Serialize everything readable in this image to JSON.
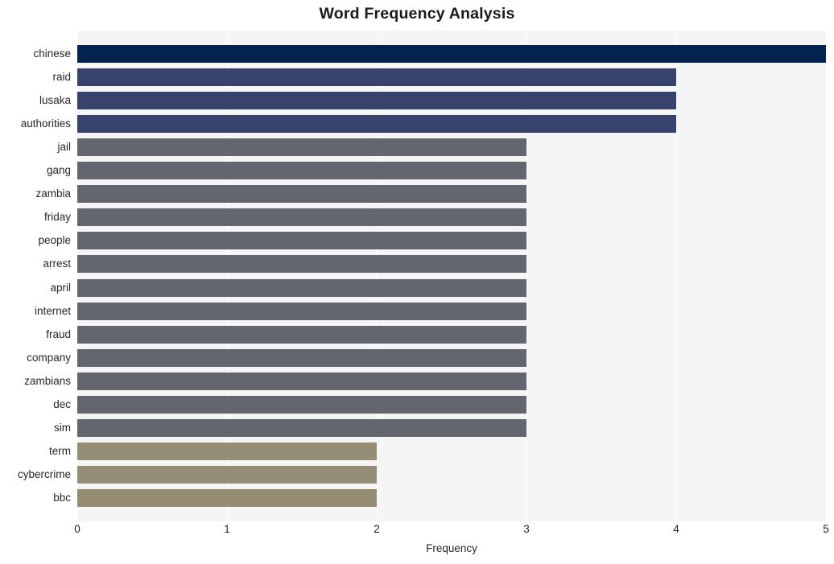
{
  "chart_data": {
    "type": "bar",
    "orientation": "horizontal",
    "title": "Word Frequency Analysis",
    "xlabel": "Frequency",
    "ylabel": "",
    "xlim": [
      0,
      5
    ],
    "ylim": [
      0,
      20
    ],
    "grid": true,
    "legend": false,
    "xticks": [
      "0",
      "1",
      "2",
      "3",
      "4",
      "5"
    ],
    "xtick_values": [
      0,
      1,
      2,
      3,
      4,
      5
    ],
    "categories": [
      "chinese",
      "raid",
      "lusaka",
      "authorities",
      "jail",
      "gang",
      "zambia",
      "friday",
      "people",
      "arrest",
      "april",
      "internet",
      "fraud",
      "company",
      "zambians",
      "dec",
      "sim",
      "term",
      "cybercrime",
      "bbc"
    ],
    "values": [
      5,
      4,
      4,
      4,
      3,
      3,
      3,
      3,
      3,
      3,
      3,
      3,
      3,
      3,
      3,
      3,
      3,
      2,
      2,
      2
    ],
    "bar_colors": [
      "#04244f",
      "#37436c",
      "#37436c",
      "#37436c",
      "#63666f",
      "#63666f",
      "#63666f",
      "#63666f",
      "#63666f",
      "#63666f",
      "#63666f",
      "#63666f",
      "#63666f",
      "#63666f",
      "#63666f",
      "#63666f",
      "#63666f",
      "#958d76",
      "#958d76",
      "#958d76"
    ],
    "plot_background": "#f5f5f5",
    "gridline_color": "#ffffff",
    "figure_background": "#ffffff"
  }
}
